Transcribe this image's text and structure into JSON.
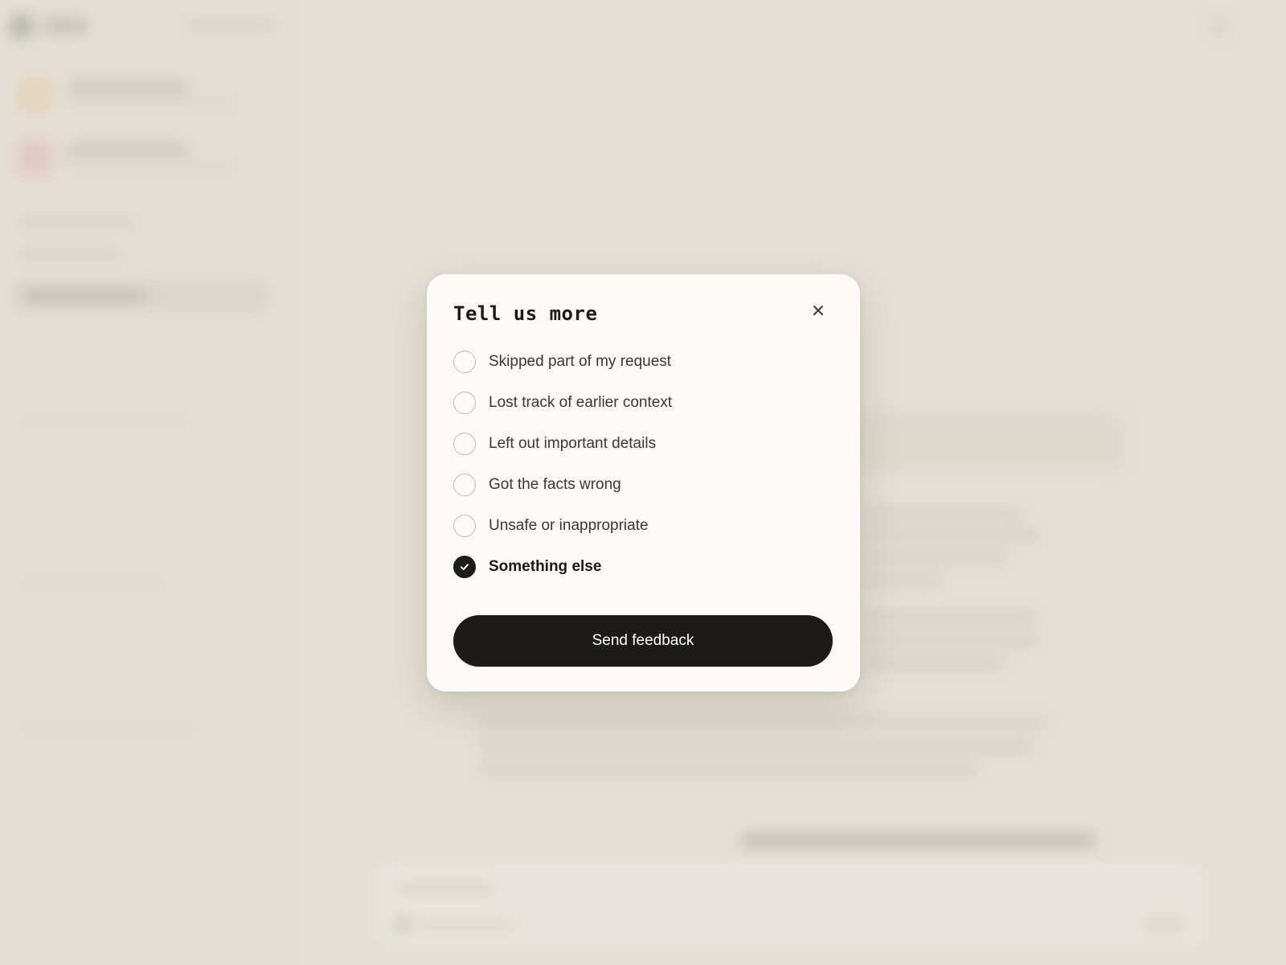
{
  "modal": {
    "title": "Tell us more",
    "close_icon": "close-icon",
    "options": [
      {
        "label": "Skipped part of my request",
        "checked": false
      },
      {
        "label": "Lost track of earlier context",
        "checked": false
      },
      {
        "label": "Left out important details",
        "checked": false
      },
      {
        "label": "Got the facts wrong",
        "checked": false
      },
      {
        "label": "Unsafe or inappropriate",
        "checked": false
      },
      {
        "label": "Something else",
        "checked": true
      }
    ],
    "submit_label": "Send feedback"
  },
  "colors": {
    "background": "#e6e0d9",
    "modal_bg": "#fbfaf7",
    "primary": "#1c1b18",
    "radio_border": "#bdbab3"
  }
}
